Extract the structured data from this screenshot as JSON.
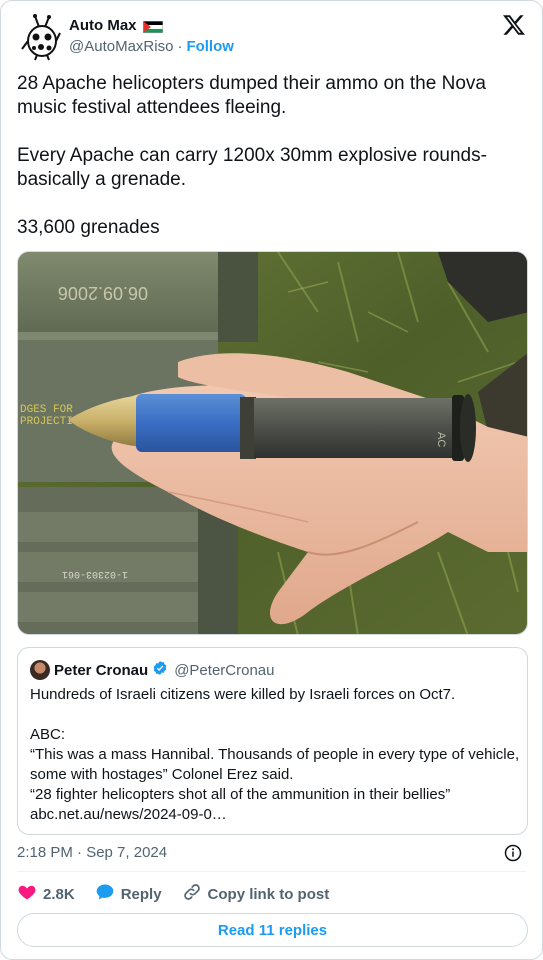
{
  "author": {
    "name": "Auto Max",
    "handle": "@AutoMaxRiso",
    "follow_label": "Follow",
    "flag_icon": "palestine-flag-icon"
  },
  "tweet": {
    "text": "28 Apache helicopters dumped their ammo on the Nova music festival attendees fleeing.\n\nEvery Apache can carry 1200x 30mm explosive rounds- basically a grenade.\n\n33,600 grenades",
    "media_text": {
      "box_top_stamp": "06.09.2006",
      "box_side_text": "DGES FOR\nPROJECTILES",
      "box_bottom_stamp": "1-02303-061"
    }
  },
  "quote": {
    "name": "Peter Cronau",
    "handle": "@PeterCronau",
    "text": "Hundreds of Israeli citizens were killed by Israeli forces on Oct7.\n\nABC:\n“This was a mass Hannibal. Thousands of people in every type of vehicle, some with hostages” Colonel Erez said.\n“28 fighter helicopters shot all of the ammunition in their bellies”\nabc.net.au/news/2024-09-0…"
  },
  "meta": {
    "timestamp": "2:18 PM · Sep 7, 2024"
  },
  "actions": {
    "likes": "2.8K",
    "reply_label": "Reply",
    "copy_label": "Copy link to post",
    "read_replies_label": "Read 11 replies"
  },
  "colors": {
    "accent": "#1d9bf0",
    "like": "#f91880",
    "text_secondary": "#536471",
    "verified": "#1d9bf0"
  }
}
